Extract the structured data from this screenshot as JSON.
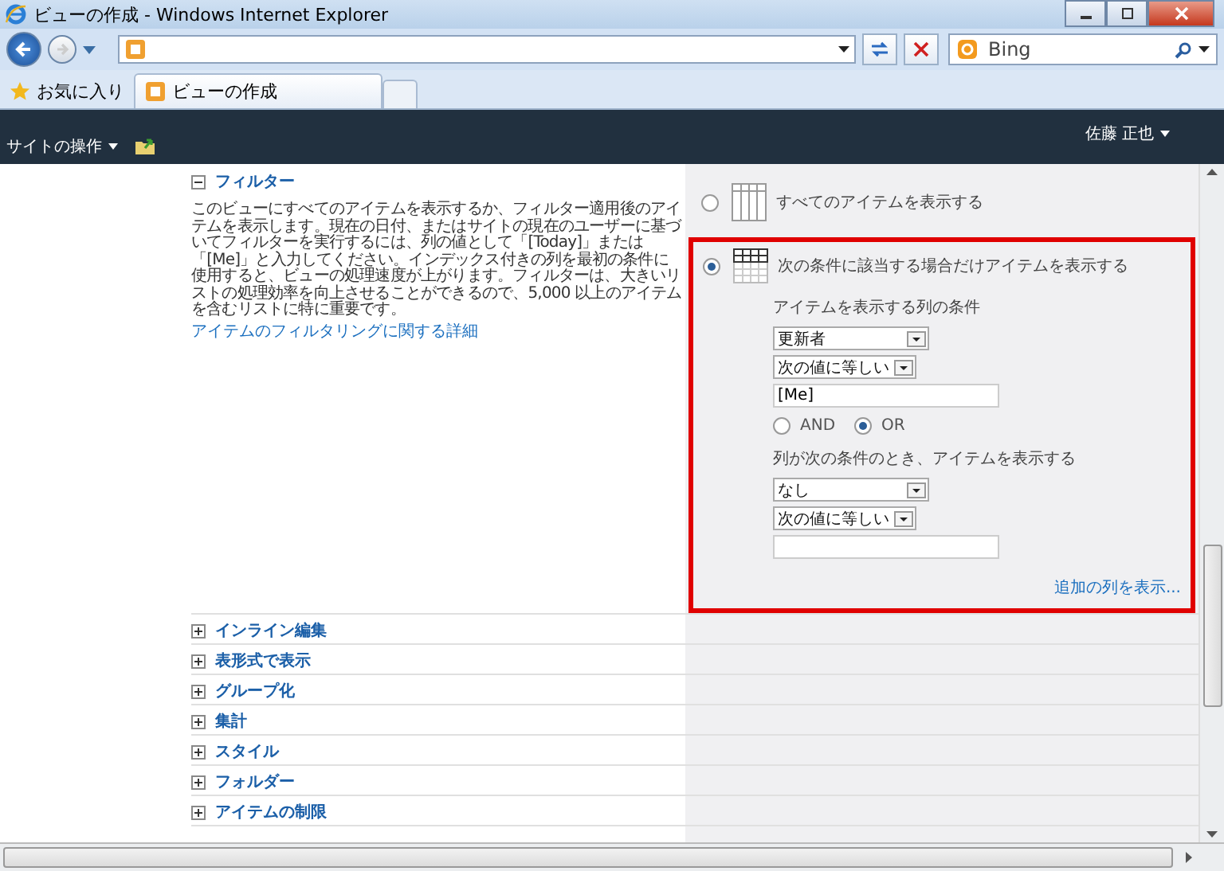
{
  "window": {
    "title": "ビューの作成 - Windows Internet Explorer"
  },
  "navigation": {
    "search_placeholder": "Bing"
  },
  "favorites": {
    "label": "お気に入り"
  },
  "tabs": [
    {
      "label": "ビューの作成",
      "selected": true
    }
  ],
  "ribbon": {
    "site_actions": "サイトの操作",
    "user": "佐藤 正也"
  },
  "filter_section": {
    "title": "フィルター",
    "expanded": true,
    "description": "このビューにすべてのアイテムを表示するか、フィルター適用後のアイテムを表示します。現在の日付、またはサイトの現在のユーザーに基づいてフィルターを実行するには、列の値として「[Today]」または「[Me]」と入力してください。インデックス付きの列を最初の条件に使用すると、ビューの処理速度が上がります。フィルターは、大きいリストの処理効率を向上させることができるので、5,000 以上のアイテムを含むリストに特に重要です。",
    "link": "アイテムのフィルタリングに関する詳細",
    "options": [
      {
        "label": "すべてのアイテムを表示する",
        "selected": false,
        "highlighted": false
      },
      {
        "label": "次の条件に該当する場合だけアイテムを表示する",
        "selected": true,
        "highlighted": true
      }
    ],
    "conditions": {
      "first_label": "アイテムを表示する列の条件",
      "first_column": "更新者",
      "first_operator": "次の値に等しい",
      "first_value": "[Me]",
      "logic": [
        {
          "label": "AND",
          "selected": false
        },
        {
          "label": "OR",
          "selected": true
        }
      ],
      "second_label": "列が次の条件のとき、アイテムを表示する",
      "second_column": "なし",
      "second_operator": "次の値に等しい",
      "more_link": "追加の列を表示..."
    }
  },
  "other_sections": [
    {
      "title": "インライン編集",
      "expanded": false
    },
    {
      "title": "表形式で表示",
      "expanded": false
    },
    {
      "title": "グループ化",
      "expanded": false
    },
    {
      "title": "集計",
      "expanded": false
    },
    {
      "title": "スタイル",
      "expanded": false
    },
    {
      "title": "フォルダー",
      "expanded": false
    },
    {
      "title": "アイテムの制限",
      "expanded": false
    }
  ]
}
